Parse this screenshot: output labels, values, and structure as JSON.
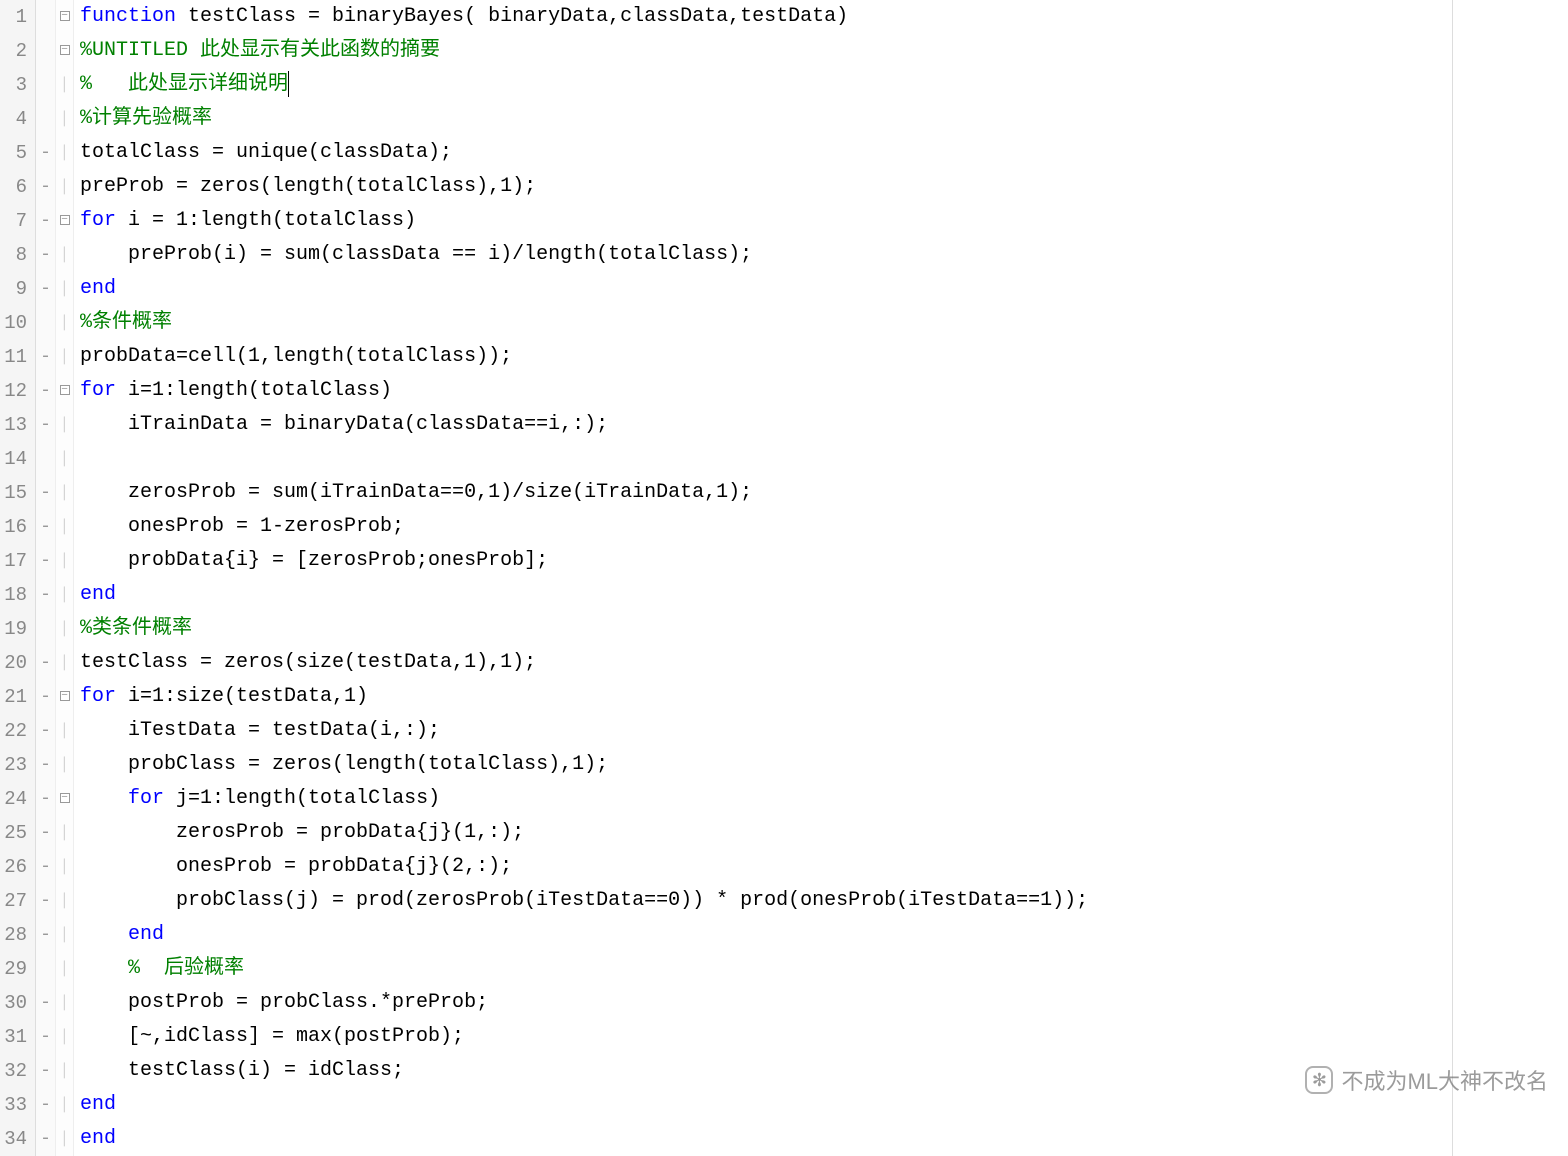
{
  "watermark_text": "不成为ML大神不改名",
  "lines": [
    {
      "n": 1,
      "bp": "",
      "fold": "box",
      "tokens": [
        {
          "c": "kw",
          "t": "function"
        },
        {
          "c": "txt",
          "t": " testClass = binaryBayes( binaryData,classData,testData)"
        }
      ]
    },
    {
      "n": 2,
      "bp": "",
      "fold": "box",
      "tokens": [
        {
          "c": "com",
          "t": "%UNTITLED 此处显示有关此函数的摘要"
        }
      ]
    },
    {
      "n": 3,
      "bp": "",
      "fold": "line",
      "tokens": [
        {
          "c": "com",
          "t": "%   此处显示详细说明"
        }
      ]
    },
    {
      "n": 4,
      "bp": "",
      "fold": "line",
      "tokens": [
        {
          "c": "com",
          "t": "%计算先验概率"
        }
      ]
    },
    {
      "n": 5,
      "bp": "-",
      "fold": "line",
      "tokens": [
        {
          "c": "txt",
          "t": "totalClass = unique(classData);"
        }
      ]
    },
    {
      "n": 6,
      "bp": "-",
      "fold": "line",
      "tokens": [
        {
          "c": "txt",
          "t": "preProb = zeros(length(totalClass),1);"
        }
      ]
    },
    {
      "n": 7,
      "bp": "-",
      "fold": "box",
      "tokens": [
        {
          "c": "kw",
          "t": "for"
        },
        {
          "c": "txt",
          "t": " i = 1:length(totalClass)"
        }
      ]
    },
    {
      "n": 8,
      "bp": "-",
      "fold": "line",
      "tokens": [
        {
          "c": "txt",
          "t": "    preProb(i) = sum(classData == i)/length(totalClass);"
        }
      ]
    },
    {
      "n": 9,
      "bp": "-",
      "fold": "line",
      "tokens": [
        {
          "c": "kw",
          "t": "end"
        }
      ]
    },
    {
      "n": 10,
      "bp": "",
      "fold": "line",
      "tokens": [
        {
          "c": "com",
          "t": "%条件概率"
        }
      ]
    },
    {
      "n": 11,
      "bp": "-",
      "fold": "line",
      "tokens": [
        {
          "c": "txt",
          "t": "probData=cell(1,length(totalClass));"
        }
      ]
    },
    {
      "n": 12,
      "bp": "-",
      "fold": "box",
      "tokens": [
        {
          "c": "kw",
          "t": "for"
        },
        {
          "c": "txt",
          "t": " i=1:length(totalClass)"
        }
      ]
    },
    {
      "n": 13,
      "bp": "-",
      "fold": "line",
      "tokens": [
        {
          "c": "txt",
          "t": "    iTrainData = binaryData(classData==i,:);"
        }
      ]
    },
    {
      "n": 14,
      "bp": "",
      "fold": "line",
      "tokens": [
        {
          "c": "txt",
          "t": ""
        }
      ]
    },
    {
      "n": 15,
      "bp": "-",
      "fold": "line",
      "tokens": [
        {
          "c": "txt",
          "t": "    zerosProb = sum(iTrainData==0,1)/size(iTrainData,1);"
        }
      ]
    },
    {
      "n": 16,
      "bp": "-",
      "fold": "line",
      "tokens": [
        {
          "c": "txt",
          "t": "    onesProb = 1-zerosProb;"
        }
      ]
    },
    {
      "n": 17,
      "bp": "-",
      "fold": "line",
      "tokens": [
        {
          "c": "txt",
          "t": "    probData{i} = [zerosProb;onesProb];"
        }
      ]
    },
    {
      "n": 18,
      "bp": "-",
      "fold": "line",
      "tokens": [
        {
          "c": "kw",
          "t": "end"
        }
      ]
    },
    {
      "n": 19,
      "bp": "",
      "fold": "line",
      "tokens": [
        {
          "c": "com",
          "t": "%类条件概率"
        }
      ]
    },
    {
      "n": 20,
      "bp": "-",
      "fold": "line",
      "tokens": [
        {
          "c": "txt",
          "t": "testClass = zeros(size(testData,1),1);"
        }
      ]
    },
    {
      "n": 21,
      "bp": "-",
      "fold": "box",
      "tokens": [
        {
          "c": "kw",
          "t": "for"
        },
        {
          "c": "txt",
          "t": " i=1:size(testData,1)"
        }
      ]
    },
    {
      "n": 22,
      "bp": "-",
      "fold": "line",
      "tokens": [
        {
          "c": "txt",
          "t": "    iTestData = testData(i,:);"
        }
      ]
    },
    {
      "n": 23,
      "bp": "-",
      "fold": "line",
      "tokens": [
        {
          "c": "txt",
          "t": "    probClass = zeros(length(totalClass),1);"
        }
      ]
    },
    {
      "n": 24,
      "bp": "-",
      "fold": "box",
      "tokens": [
        {
          "c": "txt",
          "t": "    "
        },
        {
          "c": "kw",
          "t": "for"
        },
        {
          "c": "txt",
          "t": " j=1:length(totalClass)"
        }
      ]
    },
    {
      "n": 25,
      "bp": "-",
      "fold": "line",
      "tokens": [
        {
          "c": "txt",
          "t": "        zerosProb = probData{j}(1,:);"
        }
      ]
    },
    {
      "n": 26,
      "bp": "-",
      "fold": "line",
      "tokens": [
        {
          "c": "txt",
          "t": "        onesProb = probData{j}(2,:);"
        }
      ]
    },
    {
      "n": 27,
      "bp": "-",
      "fold": "line",
      "tokens": [
        {
          "c": "txt",
          "t": "        probClass(j) = prod(zerosProb(iTestData==0)) * prod(onesProb(iTestData==1));"
        }
      ]
    },
    {
      "n": 28,
      "bp": "-",
      "fold": "line",
      "tokens": [
        {
          "c": "txt",
          "t": "    "
        },
        {
          "c": "kw",
          "t": "end"
        }
      ]
    },
    {
      "n": 29,
      "bp": "",
      "fold": "line",
      "tokens": [
        {
          "c": "txt",
          "t": "    "
        },
        {
          "c": "com",
          "t": "%  后验概率"
        }
      ]
    },
    {
      "n": 30,
      "bp": "-",
      "fold": "line",
      "tokens": [
        {
          "c": "txt",
          "t": "    postProb = probClass.*preProb;"
        }
      ]
    },
    {
      "n": 31,
      "bp": "-",
      "fold": "line",
      "tokens": [
        {
          "c": "txt",
          "t": "    [~,idClass] = max(postProb);"
        }
      ]
    },
    {
      "n": 32,
      "bp": "-",
      "fold": "line",
      "tokens": [
        {
          "c": "txt",
          "t": "    testClass(i) = idClass;"
        }
      ]
    },
    {
      "n": 33,
      "bp": "-",
      "fold": "line",
      "tokens": [
        {
          "c": "kw",
          "t": "end"
        }
      ]
    },
    {
      "n": 34,
      "bp": "-",
      "fold": "line",
      "tokens": [
        {
          "c": "kw",
          "t": "end"
        }
      ]
    }
  ]
}
